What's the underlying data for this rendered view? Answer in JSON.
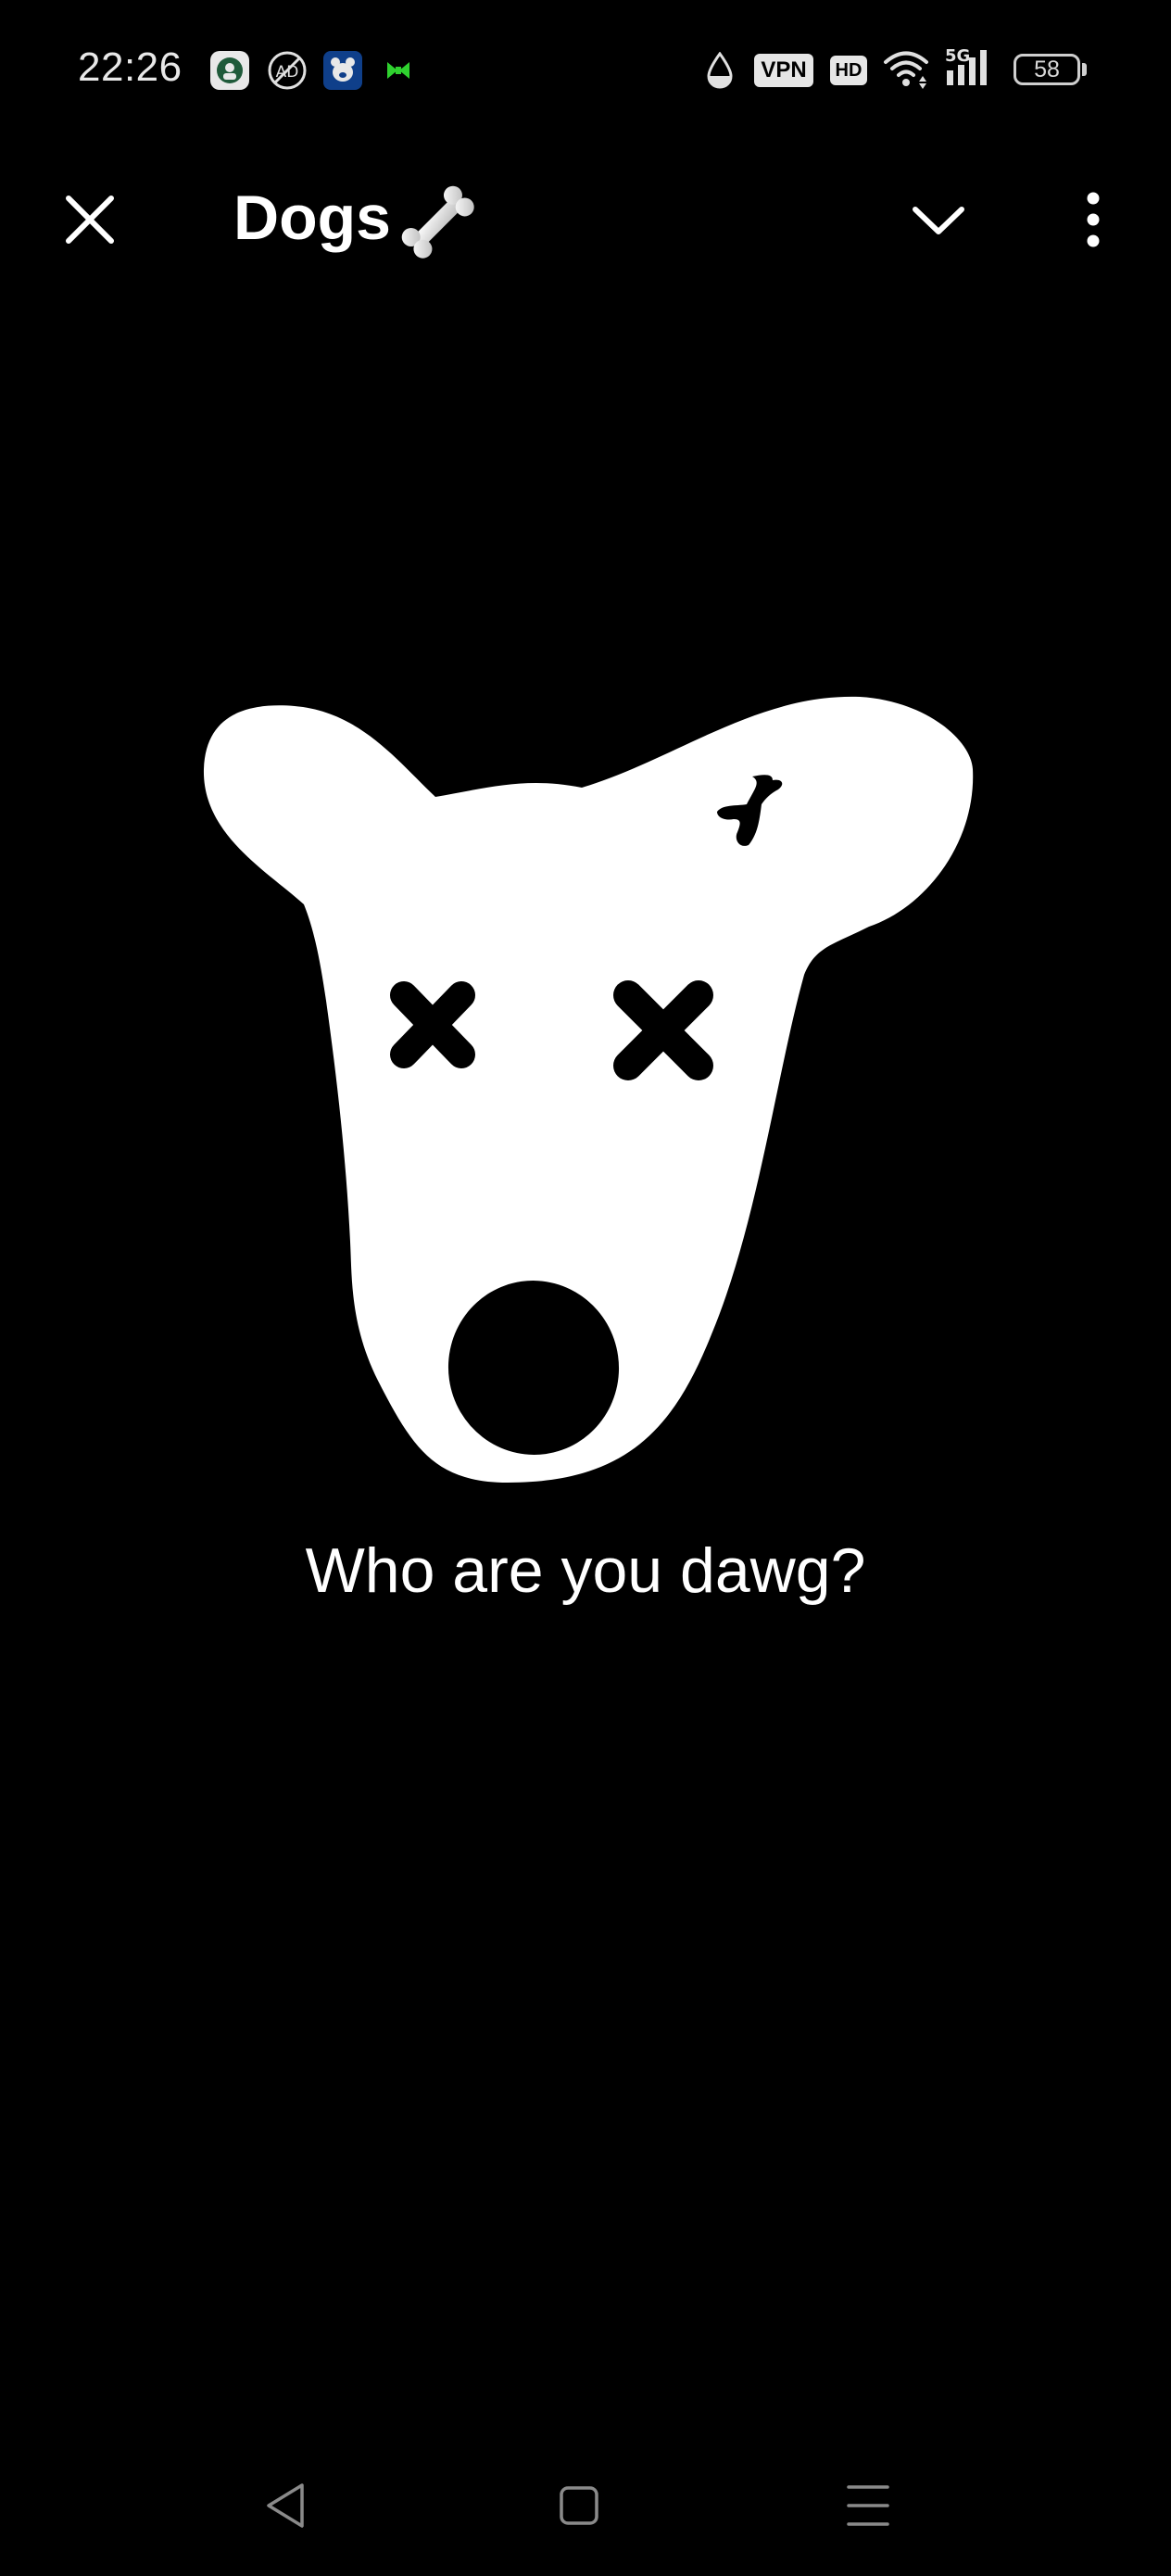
{
  "status_bar": {
    "time": "22:26",
    "notification_icons": [
      "app-notification-icon",
      "no-ads-icon",
      "bear-app-icon",
      "bow-app-icon"
    ],
    "system_icons": [
      "data-saver-icon",
      "vpn-icon",
      "hd-icon",
      "wifi-icon",
      "cellular-5g-icon",
      "battery-icon"
    ],
    "vpn_label": "VPN",
    "hd_label": "HD",
    "network_label": "5G",
    "battery_level": "58"
  },
  "app_bar": {
    "close_icon": "close-icon",
    "title": "Dogs",
    "title_emoji": "bone-emoji",
    "dropdown_icon": "chevron-down-icon",
    "more_icon": "more-vertical-icon"
  },
  "empty_state": {
    "illustration": "dog-face-illustration",
    "message": "Who are you dawg?"
  },
  "nav_bar": {
    "back": "back-triangle-icon",
    "home": "home-square-icon",
    "recents": "recents-menu-icon"
  },
  "colors": {
    "background": "#000000",
    "foreground": "#ffffff",
    "accent_green": "#2fd12f",
    "badge_blue": "#0f3f8a"
  }
}
